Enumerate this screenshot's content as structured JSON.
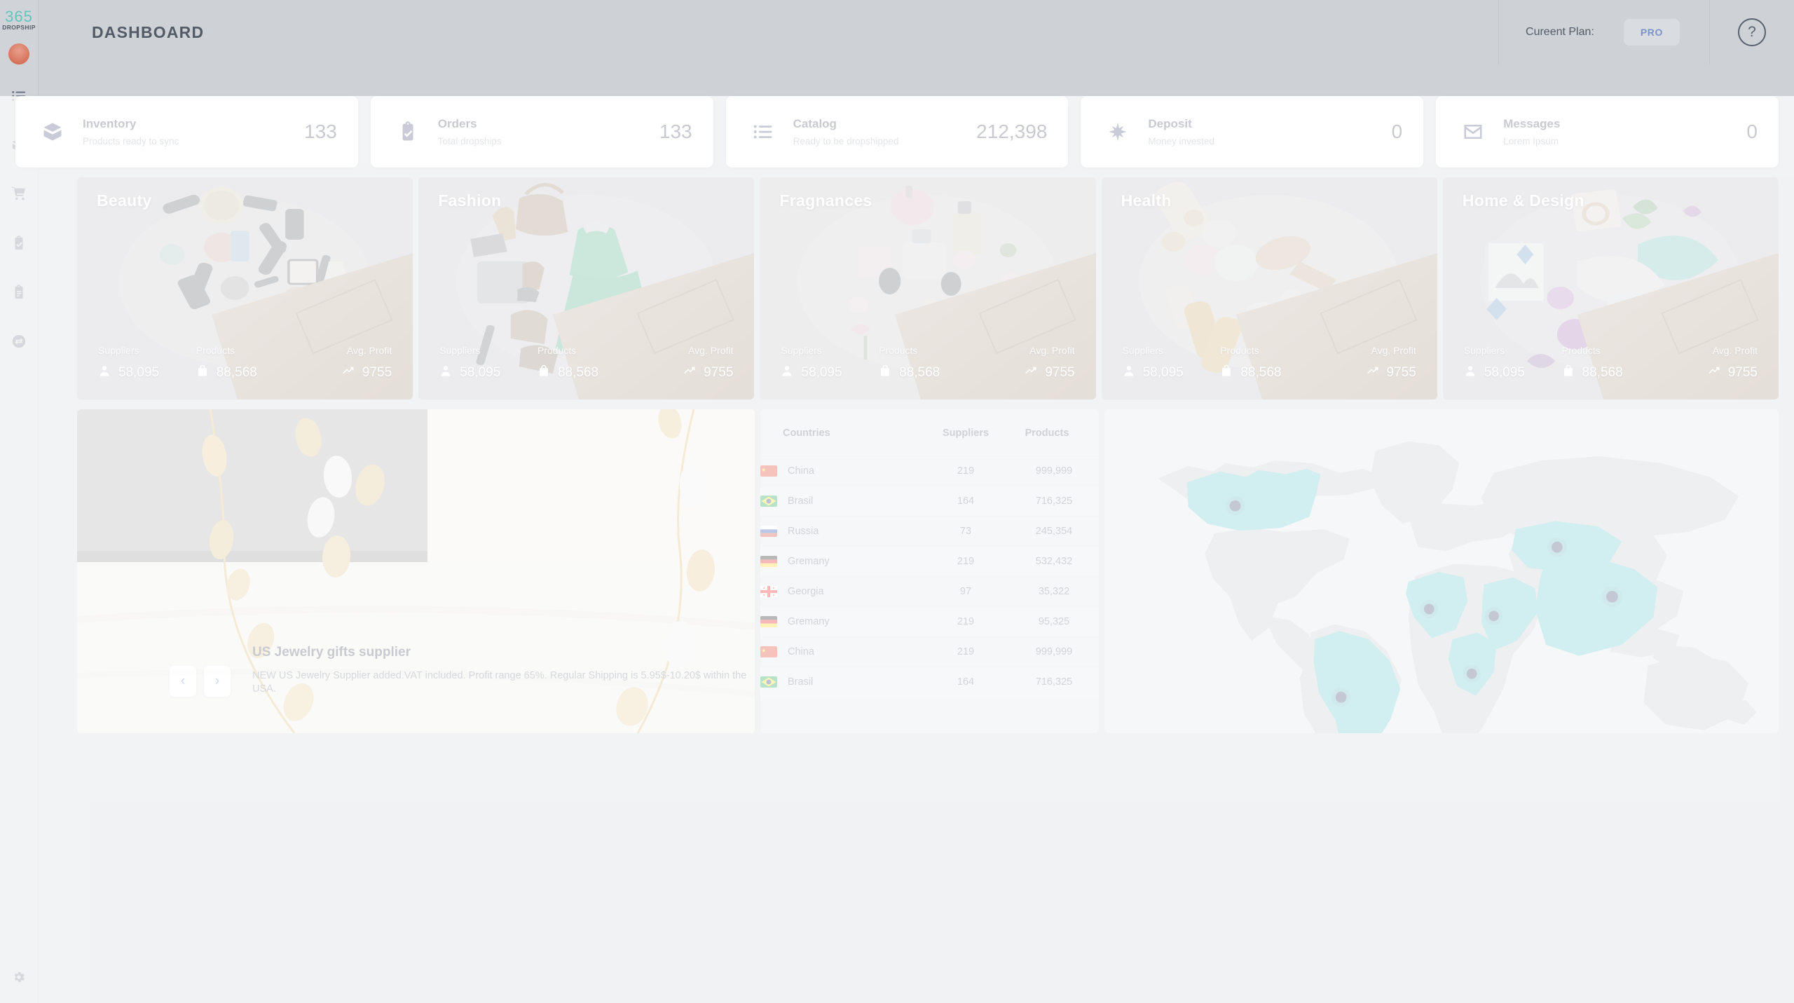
{
  "app": {
    "logo_number": "365",
    "logo_word": "DROPSHIP",
    "page_title": "DASHBOARD",
    "accent_teal": "#63c3bd",
    "accent_navy": "#3f4a73",
    "map_highlight": "#5cc3c8",
    "map_land": "#bfc4c9"
  },
  "header": {
    "plan_label": "Cureent Plan:",
    "plan_value": "PRO",
    "help_symbol": "?"
  },
  "sidebar": {
    "items": [
      {
        "icon": "list-icon",
        "name": "sidebar-item-catalog"
      },
      {
        "icon": "box-icon",
        "name": "sidebar-item-inventory"
      },
      {
        "icon": "cart-icon",
        "name": "sidebar-item-orders"
      },
      {
        "icon": "clipboard-check-icon",
        "name": "sidebar-item-tasks"
      },
      {
        "icon": "clipboard-list-icon",
        "name": "sidebar-item-reports"
      },
      {
        "icon": "sync-icon",
        "name": "sidebar-item-sync"
      }
    ],
    "settings_icon": "gear-icon"
  },
  "stats": [
    {
      "icon": "box-icon",
      "title": "Inventory",
      "subtitle": "Products ready to sync",
      "value": "133"
    },
    {
      "icon": "clipboard-check-icon",
      "title": "Orders",
      "subtitle": "Total dropships",
      "value": "133"
    },
    {
      "icon": "list-icon",
      "title": "Catalog",
      "subtitle": "Ready to be dropshipped",
      "value": "212,398"
    },
    {
      "icon": "star-icon",
      "title": "Deposit",
      "subtitle": "Money invested",
      "value": "0"
    },
    {
      "icon": "envelope-icon",
      "title": "Messages",
      "subtitle": "Lorem Ipsum",
      "value": "0"
    }
  ],
  "category_stat_labels": {
    "suppliers": "Suppliers",
    "products": "Products",
    "avg_profit": "Avg. Profit"
  },
  "categories": [
    {
      "title": "Beauty",
      "suppliers": "58,095",
      "products": "88,568",
      "avg_profit": "9755"
    },
    {
      "title": "Fashion",
      "suppliers": "58,095",
      "products": "88,568",
      "avg_profit": "9755"
    },
    {
      "title": "Fragnances",
      "suppliers": "58,095",
      "products": "88,568",
      "avg_profit": "9755"
    },
    {
      "title": "Health",
      "suppliers": "58,095",
      "products": "88,568",
      "avg_profit": "9755"
    },
    {
      "title": "Home & Design",
      "suppliers": "58,095",
      "products": "88,568",
      "avg_profit": "9755"
    }
  ],
  "promo": {
    "title": "US Jewelry gifts supplier",
    "description": "NEW US Jewelry Supplier added.VAT included. Profit range 65%. Regular Shipping is 5.95$-10.20$ within the USA.",
    "prev_symbol": "‹",
    "next_symbol": "›"
  },
  "countries_table": {
    "headers": {
      "name": "Countries",
      "suppliers": "Suppliers",
      "products": "Products"
    },
    "rows": [
      {
        "country": "China",
        "flag": "cn",
        "suppliers": "219",
        "products": "999,999"
      },
      {
        "country": "Brasil",
        "flag": "br",
        "suppliers": "164",
        "products": "716,325"
      },
      {
        "country": "Russia",
        "flag": "ru",
        "suppliers": "73",
        "products": "245,354"
      },
      {
        "country": "Gremany",
        "flag": "de",
        "suppliers": "219",
        "products": "532,432"
      },
      {
        "country": "Georgia",
        "flag": "ge",
        "suppliers": "97",
        "products": "35,322"
      },
      {
        "country": "Gremany",
        "flag": "de",
        "suppliers": "219",
        "products": "95,325"
      },
      {
        "country": "China",
        "flag": "cn",
        "suppliers": "219",
        "products": "999,999"
      },
      {
        "country": "Brasil",
        "flag": "br",
        "suppliers": "164",
        "products": "716,325"
      }
    ]
  },
  "map": {
    "highlighted_regions": [
      "Canada",
      "Brazil",
      "Algeria",
      "Saudi Arabia",
      "Kazakhstan",
      "China",
      "DR Congo"
    ]
  }
}
